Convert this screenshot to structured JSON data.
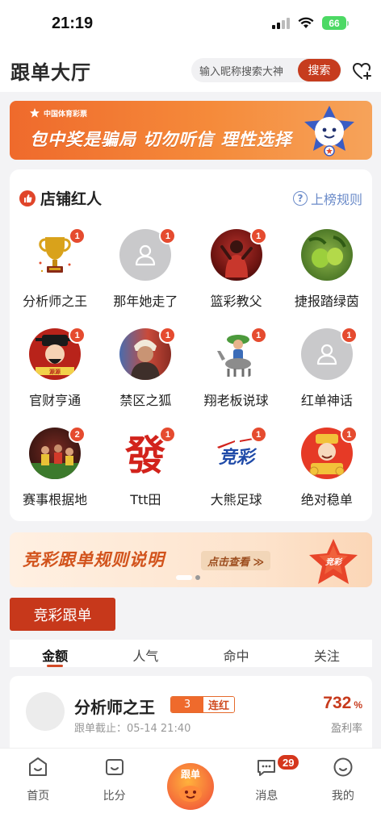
{
  "status_bar": {
    "time": "21:19",
    "battery": "66"
  },
  "header": {
    "title": "跟单大厅",
    "search_placeholder": "输入昵称搜索大神",
    "search_button": "搜索"
  },
  "banner_top": {
    "logo_text": "中国体育彩票",
    "text": "包中奖是骗局 切勿听信 理性选择"
  },
  "shop_section": {
    "title": "店铺红人",
    "rule_link": "上榜规则",
    "items": [
      {
        "name": "分析师之王",
        "badge": "1",
        "avatar": "trophy"
      },
      {
        "name": "那年她走了",
        "badge": "1",
        "avatar": "default"
      },
      {
        "name": "篮彩教父",
        "badge": "1",
        "avatar": "photo-red"
      },
      {
        "name": "捷报踏绿茵",
        "badge": "",
        "avatar": "photo-green"
      },
      {
        "name": "官财亨通",
        "badge": "1",
        "avatar": "god-of-wealth"
      },
      {
        "name": "禁区之狐",
        "badge": "1",
        "avatar": "photo-person"
      },
      {
        "name": "翔老板说球",
        "badge": "1",
        "avatar": "donkey-rider"
      },
      {
        "name": "红单神话",
        "badge": "1",
        "avatar": "default"
      },
      {
        "name": "赛事根据地",
        "badge": "2",
        "avatar": "photo-team"
      },
      {
        "name": "Ttt田",
        "badge": "1",
        "avatar": "char-fa"
      },
      {
        "name": "大熊足球",
        "badge": "1",
        "avatar": "jingcai-logo"
      },
      {
        "name": "绝对稳单",
        "badge": "1",
        "avatar": "god-of-wealth-2"
      }
    ]
  },
  "banner_rules": {
    "text": "竞彩跟单规则说明",
    "button": "点击查看 ≫"
  },
  "section_button": "竞彩跟单",
  "tabs": [
    {
      "label": "金额",
      "active": true
    },
    {
      "label": "人气",
      "active": false
    },
    {
      "label": "命中",
      "active": false
    },
    {
      "label": "关注",
      "active": false
    }
  ],
  "entry": {
    "name": "分析师之王",
    "streak_count": "3",
    "streak_label": "连红",
    "deadline": "跟单截止：05-14 21:40",
    "rate": "732",
    "rate_unit": "%",
    "rate_label": "盈利率"
  },
  "bottom_nav": {
    "home": "首页",
    "score": "比分",
    "center": "跟单",
    "messages": "消息",
    "messages_badge": "29",
    "mine": "我的"
  },
  "colors": {
    "accent": "#c7381b",
    "banner_orange": "#ef6a2c",
    "link_blue": "#6b8bc9"
  }
}
